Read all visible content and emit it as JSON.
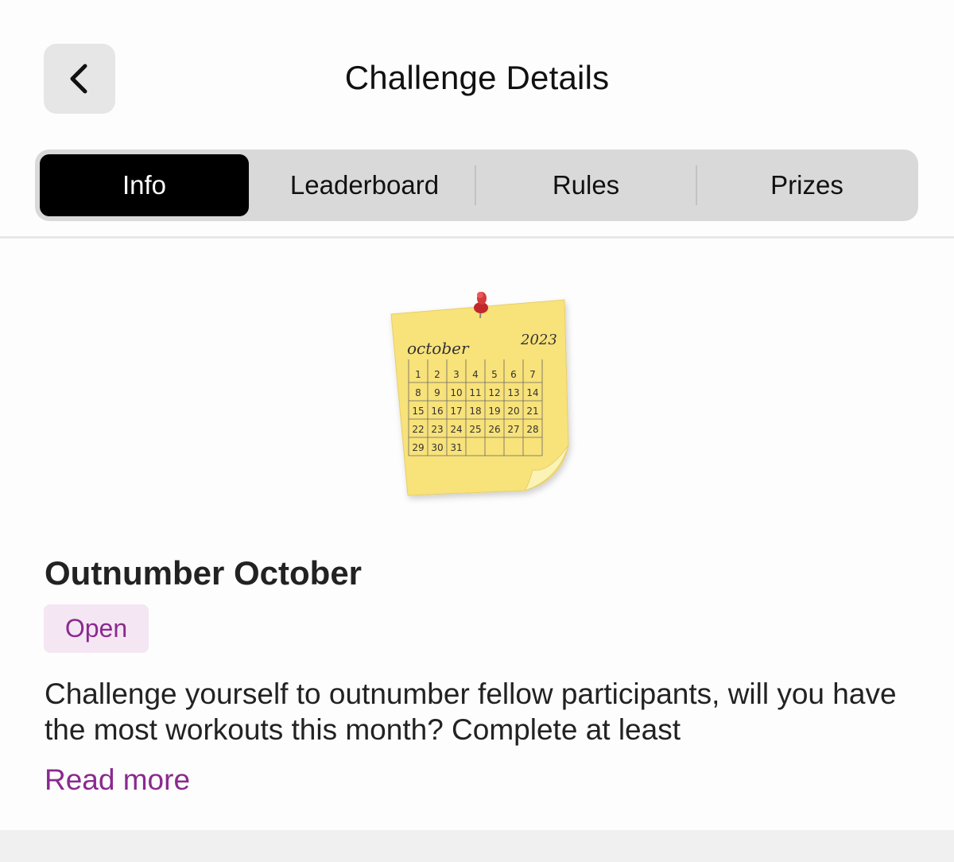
{
  "header": {
    "back_icon": "chevron-left-icon",
    "title": "Challenge Details"
  },
  "tabs": [
    {
      "label": "Info",
      "active": true
    },
    {
      "label": "Leaderboard",
      "active": false
    },
    {
      "label": "Rules",
      "active": false
    },
    {
      "label": "Prizes",
      "active": false
    }
  ],
  "hero_image": {
    "month": "october",
    "year": "2023",
    "days": [
      "1",
      "2",
      "3",
      "4",
      "5",
      "6",
      "7",
      "8",
      "9",
      "10",
      "11",
      "12",
      "13",
      "14",
      "15",
      "16",
      "17",
      "18",
      "19",
      "20",
      "21",
      "22",
      "23",
      "24",
      "25",
      "26",
      "27",
      "28",
      "29",
      "30",
      "31"
    ]
  },
  "challenge": {
    "title": "Outnumber October",
    "status": "Open",
    "description": "Challenge yourself to outnumber fellow participants, will you have the most workouts this month? Complete at least",
    "read_more": "Read more"
  },
  "colors": {
    "accent": "#8a2a8e",
    "badge_bg": "#f5e6f3",
    "tab_active_bg": "#000000",
    "tab_bar_bg": "#d9d9d9",
    "note_yellow": "#f8e27a"
  }
}
